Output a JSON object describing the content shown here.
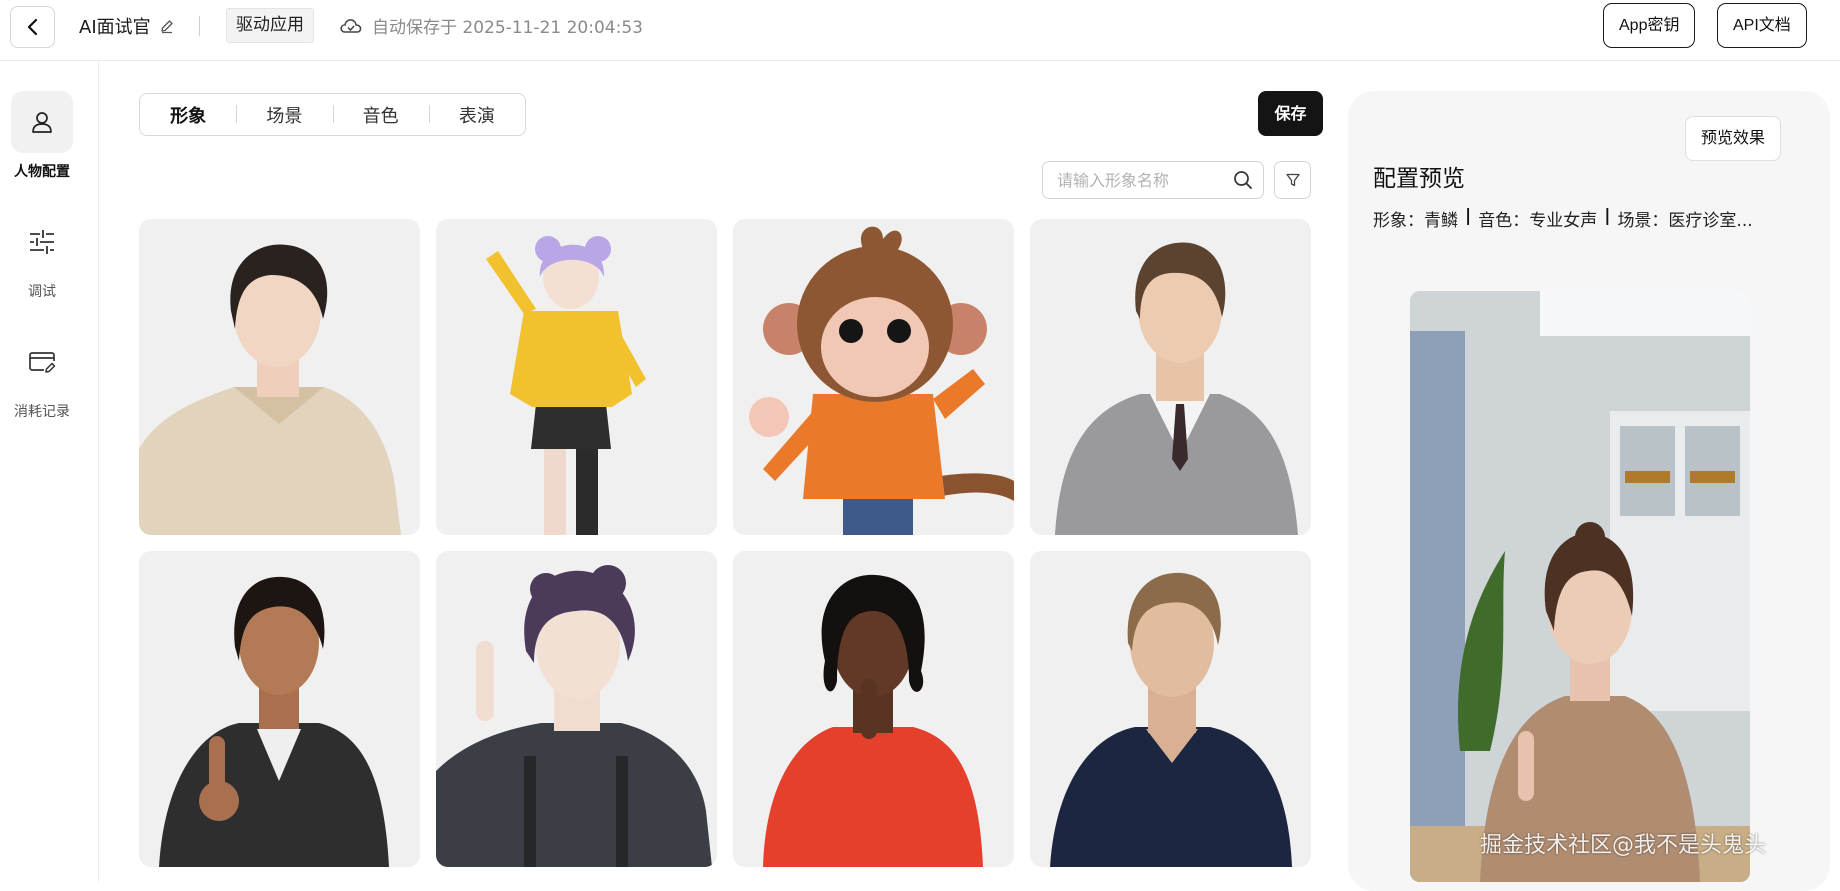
{
  "header": {
    "app_name": "AI面试官",
    "mode_tag": "驱动应用",
    "autosave_text": "自动保存于 2025-11-21 20:04:53",
    "app_key_label": "App密钥",
    "api_doc_label": "API文档"
  },
  "rail": {
    "items": [
      {
        "label": "人物配置",
        "icon": "person-icon",
        "active": true
      },
      {
        "label": "调试",
        "icon": "sliders-icon",
        "active": false
      },
      {
        "label": "消耗记录",
        "icon": "card-edit-icon",
        "active": false
      }
    ]
  },
  "tabs": [
    {
      "label": "形象",
      "active": true
    },
    {
      "label": "场景",
      "active": false
    },
    {
      "label": "音色",
      "active": false
    },
    {
      "label": "表演",
      "active": false
    }
  ],
  "save_label": "保存",
  "search": {
    "placeholder": "请输入形象名称",
    "value": ""
  },
  "avatars": [
    {
      "kind": "woman in beige knit top"
    },
    {
      "kind": "anime girl in yellow jacket"
    },
    {
      "kind": "cartoon monkey in orange shirt"
    },
    {
      "kind": "man in grey suit"
    },
    {
      "kind": "woman in black leather jacket"
    },
    {
      "kind": "young man with purple hair"
    },
    {
      "kind": "woman in red top"
    },
    {
      "kind": "man in navy polo"
    }
  ],
  "preview": {
    "button_label": "预览效果",
    "title": "配置预览",
    "summary_avatar": "形象：青鳞",
    "summary_voice": "音色：专业女声",
    "summary_scene": "场景：医疗诊室...",
    "separator": "|"
  },
  "watermark": "掘金技术社区@我不是头鬼头",
  "colors": {
    "accent": "#141414",
    "panel": "#f6f6f6",
    "card": "#f0f0f0"
  }
}
